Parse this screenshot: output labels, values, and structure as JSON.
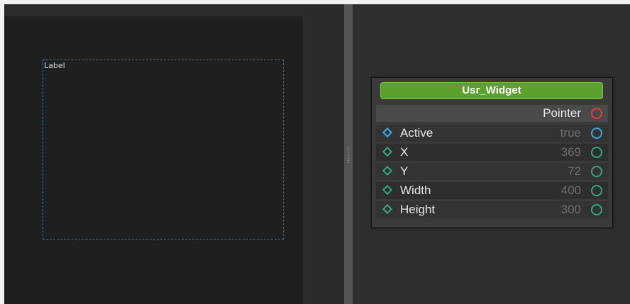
{
  "canvas": {
    "widget_label": "Label"
  },
  "node": {
    "title": "Usr_Widget",
    "pointer_label": "Pointer",
    "rows": [
      {
        "label": "Active",
        "value": "true"
      },
      {
        "label": "X",
        "value": "369"
      },
      {
        "label": "Y",
        "value": "72"
      },
      {
        "label": "Width",
        "value": "400"
      },
      {
        "label": "Height",
        "value": "300"
      }
    ]
  },
  "colors": {
    "header_green": "#5ca12c",
    "pin_red": "#e03c3c",
    "pin_blue": "#3fa8e0",
    "pin_green": "#33a580",
    "frame_dashed": "#3f6f88"
  },
  "icons": {
    "input_pin": "diamond-pin-icon",
    "output_pin": "circle-pin-icon"
  }
}
